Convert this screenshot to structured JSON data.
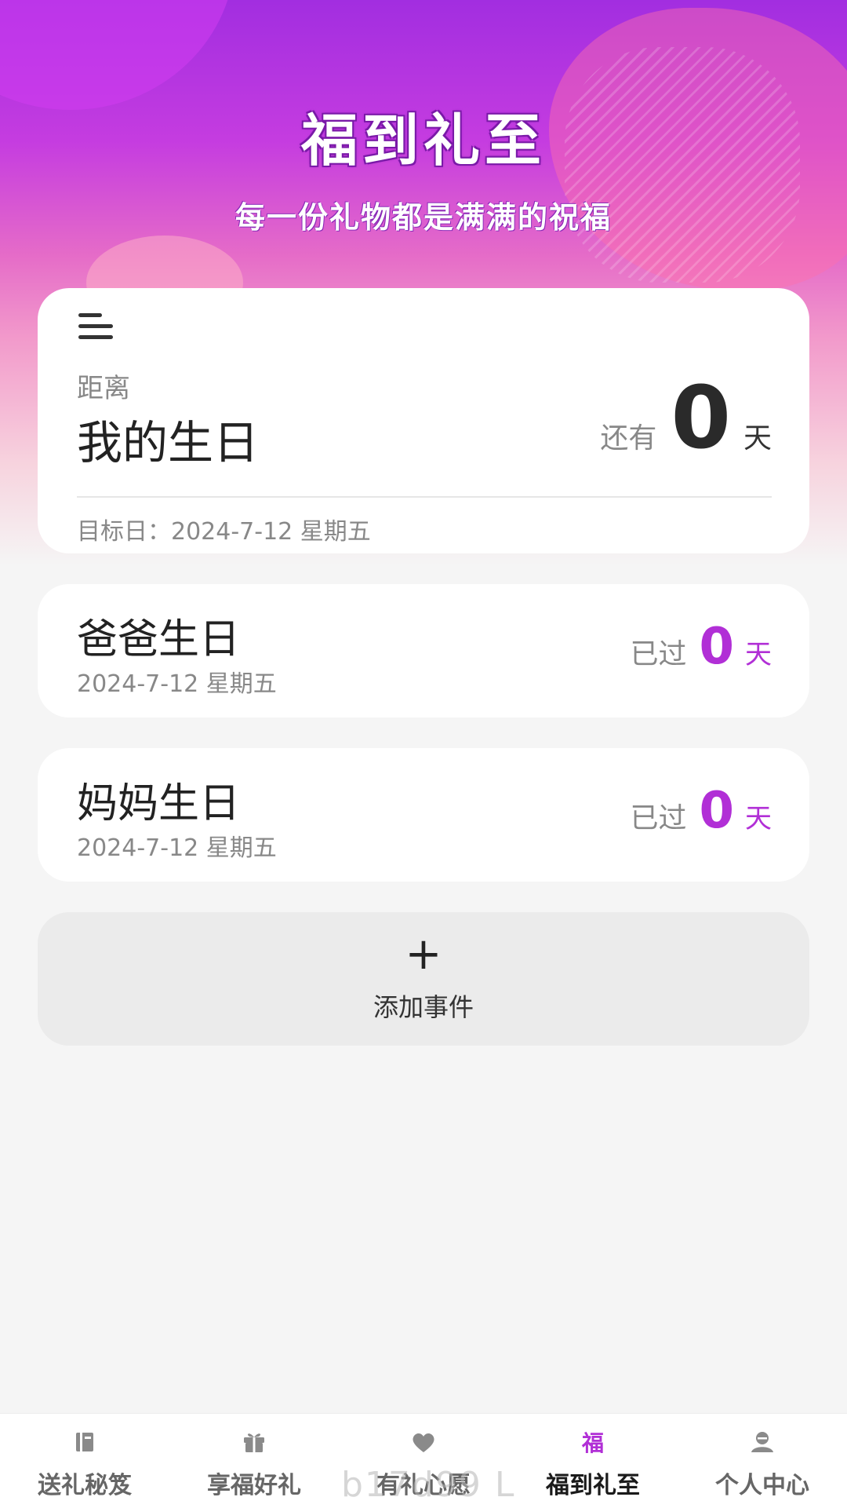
{
  "header": {
    "title": "福到礼至",
    "subtitle": "每一份礼物都是满满的祝福"
  },
  "main_event": {
    "distance_label": "距离",
    "name": "我的生日",
    "prefix": "还有",
    "days": "0",
    "unit": "天",
    "target_date": "目标日：2024-7-12 星期五"
  },
  "events": [
    {
      "name": "爸爸生日",
      "date": "2024-7-12 星期五",
      "prefix": "已过",
      "days": "0",
      "unit": "天"
    },
    {
      "name": "妈妈生日",
      "date": "2024-7-12 星期五",
      "prefix": "已过",
      "days": "0",
      "unit": "天"
    }
  ],
  "add_button": {
    "plus": "+",
    "label": "添加事件"
  },
  "tabbar": {
    "items": [
      {
        "label": "送礼秘笈",
        "icon": "book-icon"
      },
      {
        "label": "享福好礼",
        "icon": "gift-icon"
      },
      {
        "label": "有礼心愿",
        "icon": "heart-icon"
      },
      {
        "label": "福到礼至",
        "icon": "fu-icon",
        "active": true
      },
      {
        "label": "个人中心",
        "icon": "user-icon"
      }
    ]
  },
  "watermark": "b17d99 L",
  "colors": {
    "accent": "#b12fd6",
    "hero_top": "#a22ee0",
    "hero_mid": "#e56bc8"
  }
}
